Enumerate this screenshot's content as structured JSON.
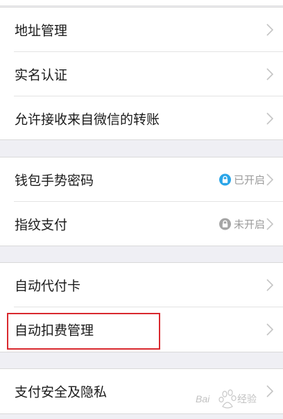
{
  "colors": {
    "background": "#efeff4",
    "row_background": "#ffffff",
    "text": "#1a1a1a",
    "secondary_text": "#9b9b9b",
    "lock_enabled": "#2aa5e8",
    "lock_disabled": "#a5a5a5",
    "highlight_box": "#d9282e"
  },
  "groups": [
    {
      "rows": [
        {
          "label": "地址管理",
          "icon": "chevron-right-icon"
        },
        {
          "label": "实名认证",
          "icon": "chevron-right-icon"
        },
        {
          "label": "允许接收来自微信的转账",
          "icon": "chevron-right-icon"
        }
      ]
    },
    {
      "rows": [
        {
          "label": "钱包手势密码",
          "status": "已开启",
          "status_icon": "lock-enabled-icon",
          "icon": "chevron-right-icon"
        },
        {
          "label": "指纹支付",
          "status": "未开启",
          "status_icon": "lock-disabled-icon",
          "icon": "chevron-right-icon"
        }
      ]
    },
    {
      "rows": [
        {
          "label": "自动代付卡",
          "icon": "chevron-right-icon"
        },
        {
          "label": "自动扣费管理",
          "icon": "chevron-right-icon",
          "highlighted": true
        }
      ]
    },
    {
      "rows": [
        {
          "label": "支付安全及隐私",
          "icon": "chevron-right-icon"
        }
      ]
    }
  ],
  "watermark": {
    "text": "Baidu 经验"
  }
}
